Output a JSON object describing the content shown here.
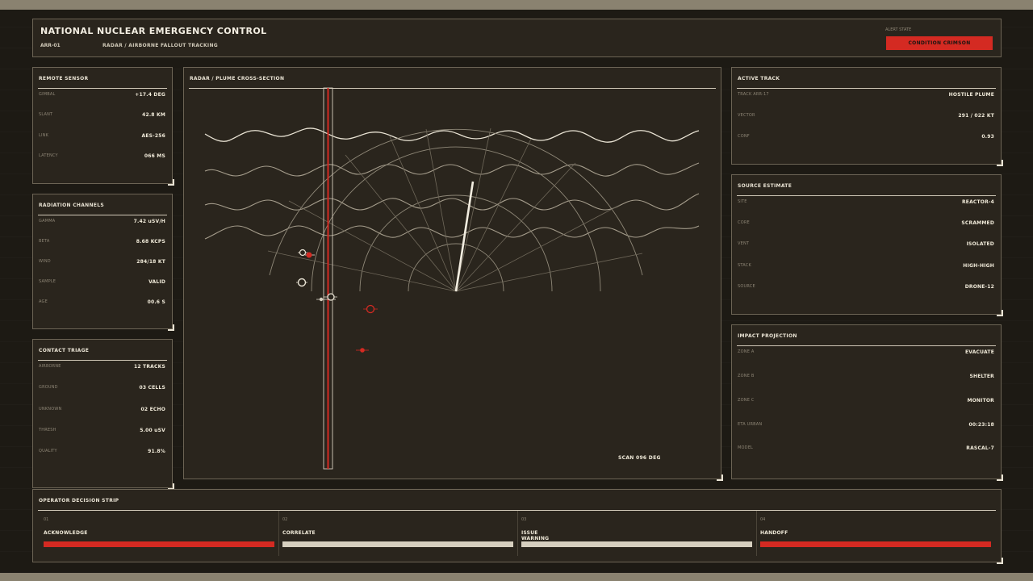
{
  "header": {
    "title": "NATIONAL NUCLEAR EMERGENCY CONTROL",
    "id": "ARR-01",
    "subtitle": "RADAR / AIRBORNE FALLOUT TRACKING",
    "alert_label": "ALERT STATE",
    "alert_value": "CONDITION CRIMSON"
  },
  "remote_sensor": {
    "title": "REMOTE SENSOR",
    "rows": [
      {
        "k": "GIMBAL",
        "v": "+17.4 DEG"
      },
      {
        "k": "SLANT",
        "v": "42.8 KM"
      },
      {
        "k": "LINK",
        "v": "AES-256"
      },
      {
        "k": "LATENCY",
        "v": "066 MS"
      }
    ]
  },
  "radiation_channels": {
    "title": "RADIATION CHANNELS",
    "rows": [
      {
        "k": "GAMMA",
        "v": "7.42 uSV/H"
      },
      {
        "k": "BETA",
        "v": "8.68 KCPS"
      },
      {
        "k": "WIND",
        "v": "284/18 KT"
      },
      {
        "k": "SAMPLE",
        "v": "VALID"
      },
      {
        "k": "AGE",
        "v": "00.6 S"
      }
    ]
  },
  "contact_triage": {
    "title": "CONTACT TRIAGE",
    "rows": [
      {
        "k": "AIRBORNE",
        "v": "12 TRACKS"
      },
      {
        "k": "GROUND",
        "v": "03 CELLS"
      },
      {
        "k": "UNKNOWN",
        "v": "02 ECHO"
      },
      {
        "k": "THRESH",
        "v": "5.00 uSV"
      },
      {
        "k": "QUALITY",
        "v": "91.8%"
      }
    ]
  },
  "radar": {
    "title": "RADAR / PLUME CROSS-SECTION",
    "scan": "SCAN 096 DEG",
    "colors": {
      "accent": "#d42a22",
      "line": "#e9e3d4",
      "grid": "#8f8878"
    }
  },
  "active_track": {
    "title": "ACTIVE TRACK",
    "rows": [
      {
        "k": "TRACK ARR-17",
        "v": "HOSTILE PLUME"
      },
      {
        "k": "VECTOR",
        "v": "291 / 022 KT"
      },
      {
        "k": "CONF",
        "v": "0.93"
      }
    ]
  },
  "source_estimate": {
    "title": "SOURCE ESTIMATE",
    "rows": [
      {
        "k": "SITE",
        "v": "REACTOR-4"
      },
      {
        "k": "CORE",
        "v": "SCRAMMED"
      },
      {
        "k": "VENT",
        "v": "ISOLATED"
      },
      {
        "k": "STACK",
        "v": "HIGH-HIGH"
      },
      {
        "k": "SOURCE",
        "v": "DRONE-12"
      }
    ]
  },
  "impact_projection": {
    "title": "IMPACT PROJECTION",
    "rows": [
      {
        "k": "ZONE A",
        "v": "EVACUATE"
      },
      {
        "k": "ZONE B",
        "v": "SHELTER"
      },
      {
        "k": "ZONE C",
        "v": "MONITOR"
      },
      {
        "k": "ETA URBAN",
        "v": "00:23:18"
      },
      {
        "k": "MODEL",
        "v": "RASCAL-7"
      }
    ]
  },
  "decision_strip": {
    "title": "OPERATOR DECISION STRIP",
    "steps": [
      {
        "num": "01",
        "label": "ACKNOWLEDGE",
        "color": "#d42a22"
      },
      {
        "num": "02",
        "label": "CORRELATE",
        "color": "#d6cfbf"
      },
      {
        "num": "03",
        "label": "ISSUE WARNING",
        "color": "#d6cfbf"
      },
      {
        "num": "04",
        "label": "HANDOFF",
        "color": "#d42a22"
      }
    ]
  }
}
